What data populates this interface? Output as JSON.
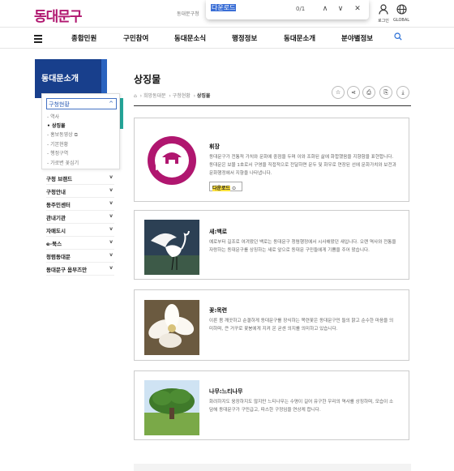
{
  "header": {
    "logo": "동대문구",
    "small_text": "동대문구청",
    "find": {
      "query": "다운로드",
      "count": "0/1",
      "up": "∧",
      "down": "∨",
      "close": "✕"
    },
    "login_label": "로그인",
    "global_label": "GLOBAL"
  },
  "gnb": {
    "items": [
      "종합민원",
      "구민참여",
      "동대문소식",
      "행정정보",
      "동대문소개",
      "분야별정보"
    ]
  },
  "sidebar": {
    "title": "동대문소개",
    "selected": "구청현황",
    "submenu": [
      "역사",
      "상징물",
      "홍보동영상",
      "기본현황",
      "행정구역",
      "가로변 꽃심기"
    ],
    "menus": [
      "구청 브랜드",
      "구청안내",
      "동주민센터",
      "관내기관",
      "자매도시",
      "e-북스",
      "청렴동대문",
      "동대문구 옴부즈만"
    ]
  },
  "main": {
    "title": "상징물",
    "breadcrumb": [
      "⌂",
      "희망동대문",
      "구청현황",
      "상징물"
    ],
    "tools": [
      "☆",
      "⋖",
      "⎙",
      "⎘",
      "⤓"
    ],
    "cards": [
      {
        "title": "휘장",
        "desc": "동대문구가 전통적 가치와 문화에 중점을 두며 이와 조화된 삶에 화합했음을 지향함을 표현합니다. 동대문은 보물 1호로서 구영을 직접적으로 전달하면 문두 및 화우로 연장된 선에 문화가치와 보전과 문화행정에서 지향을 나타냅니다.",
        "download": "다운로드"
      },
      {
        "title": "새:백로",
        "desc": "예로부터 길조로 여겨왔던 백로는 동대문구 청렴행정에서 시사해왔던 새입니다. 오랜 역사와 전통을 자랑하는 동대문구를 상징하는 새로 앞으로 동대문 구민들에게 기쁨을 주어 왔습니다."
      },
      {
        "title": "꽃:목련",
        "desc": "이른 봄 깨끗하고 순결하게 동대문구를 장식하는 목련꽃은 동대문구민 들의 맑고 순수한 마음을 의미하며, 큰 거꾸로 꽃봉에게 지켜 온 굳센 의지를 의미하고 있습니다."
      },
      {
        "title": "나무:느티나무",
        "desc": "화려하지도 웅장하지도 않지만 느티나무는 수명이 길어 유구한 우리의 역사를 상징하며, 모습이 소담해 동대문구가 구민급고, 따스한 구정임을 연상케 합니다."
      }
    ]
  },
  "colors": {
    "brand": "#b0166f",
    "navy": "#183f8c",
    "teal": "#24a79a",
    "emblem": "#b0166f"
  }
}
